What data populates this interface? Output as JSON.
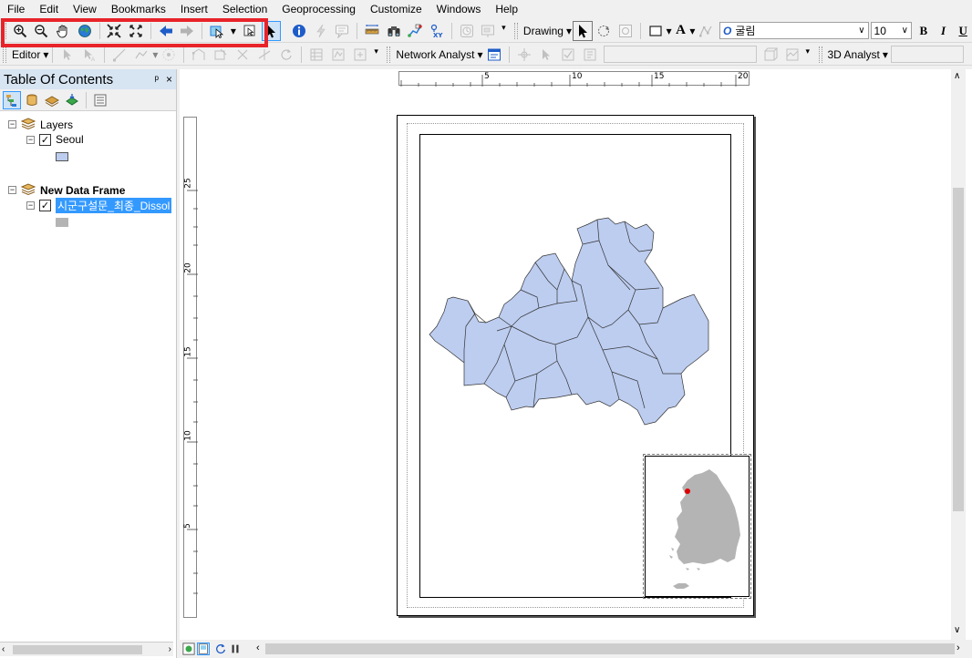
{
  "menu": [
    "File",
    "Edit",
    "View",
    "Bookmarks",
    "Insert",
    "Selection",
    "Geoprocessing",
    "Customize",
    "Windows",
    "Help"
  ],
  "toolbar1": {
    "drawing_label": "Drawing",
    "font_name": "굴림",
    "font_size": "10",
    "bold": "B",
    "italic": "I",
    "underline": "U",
    "text_tool": "A"
  },
  "toolbar2": {
    "editor_label": "Editor",
    "network_analyst_label": "Network Analyst",
    "analyst3d_label": "3D Analyst"
  },
  "toc": {
    "title": "Table Of Contents",
    "pin": "ᵖ",
    "close": "×",
    "frames": [
      {
        "name": "Layers",
        "layer": "Seoul",
        "swatch_color": "#bdcdf0"
      },
      {
        "name": "New Data Frame",
        "layer": "시군구설문_최종_Dissol",
        "swatch_color": "#b4b4b4"
      }
    ]
  },
  "rulers": {
    "horizontal": [
      "5",
      "10",
      "15",
      "20"
    ],
    "vertical": [
      "25",
      "20",
      "15",
      "10",
      "5"
    ]
  },
  "colors": {
    "seoul_fill": "#bdcdf0",
    "korea_fill": "#b4b4b4",
    "seoul_highlight": "#e00000",
    "toolbar_highlight": "#e8232a"
  }
}
